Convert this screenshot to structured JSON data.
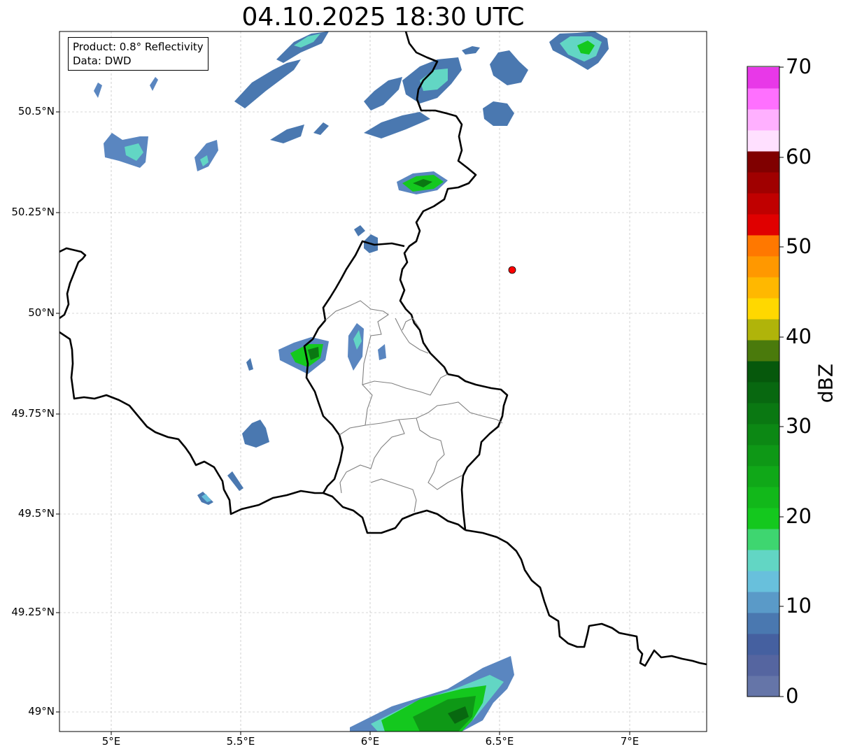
{
  "title": "04.10.2025 18:30 UTC",
  "info": {
    "product": "Product: 0.8° Reflectivity",
    "data": "Data: DWD"
  },
  "lat_labels": [
    "50.5°N",
    "50.25°N",
    "50°N",
    "49.75°N",
    "49.5°N",
    "49.25°N",
    "49°N"
  ],
  "lon_labels": [
    "5°E",
    "5.5°E",
    "6°E",
    "6.5°E",
    "7°E"
  ],
  "extent": {
    "lon_min": 4.8,
    "lon_max": 7.3,
    "lat_min": 48.95,
    "lat_max": 50.7
  },
  "marker": {
    "lon": 6.55,
    "lat": 50.11,
    "color": "#ff0000"
  },
  "colorbar": {
    "label": "dBZ",
    "ticks": [
      "0",
      "10",
      "20",
      "30",
      "40",
      "50",
      "60",
      "70"
    ],
    "colors": [
      "#6575a8",
      "#5565a0",
      "#4560a0",
      "#4a78b0",
      "#5a9ac8",
      "#68c0dc",
      "#62d6c4",
      "#3ed670",
      "#14c81e",
      "#12b81a",
      "#10a818",
      "#0e9816",
      "#0c8814",
      "#0a7812",
      "#086810",
      "#06580c",
      "#4a7a0c",
      "#b0b40a",
      "#ffd800",
      "#ffb800",
      "#ff9800",
      "#ff7800",
      "#e00000",
      "#c00000",
      "#a00000",
      "#800000",
      "#ffe0ff",
      "#ffb0ff",
      "#ff70ff",
      "#e838e8"
    ]
  },
  "chart_data": {
    "type": "map",
    "title": "04.10.2025 18:30 UTC",
    "xlim": [
      4.8,
      7.3
    ],
    "ylim": [
      48.95,
      50.7
    ],
    "colorbar_range": [
      0,
      70
    ],
    "colorbar_unit": "dBZ",
    "point_marker": {
      "lon": 6.55,
      "lat": 50.11
    },
    "reflectivity_cells": [
      {
        "lon": 5.05,
        "lat": 50.4,
        "dbz": 15
      },
      {
        "lon": 5.37,
        "lat": 50.38,
        "dbz": 15
      },
      {
        "lon": 5.6,
        "lat": 50.56,
        "dbz": 8
      },
      {
        "lon": 5.7,
        "lat": 50.66,
        "dbz": 10
      },
      {
        "lon": 6.0,
        "lat": 50.5,
        "dbz": 10
      },
      {
        "lon": 6.25,
        "lat": 50.59,
        "dbz": 12
      },
      {
        "lon": 6.21,
        "lat": 50.32,
        "dbz": 28
      },
      {
        "lon": 5.76,
        "lat": 49.9,
        "dbz": 24
      },
      {
        "lon": 5.96,
        "lat": 49.93,
        "dbz": 18
      },
      {
        "lon": 6.77,
        "lat": 50.66,
        "dbz": 22
      },
      {
        "lon": 6.25,
        "lat": 49.0,
        "dbz": 30
      }
    ]
  }
}
